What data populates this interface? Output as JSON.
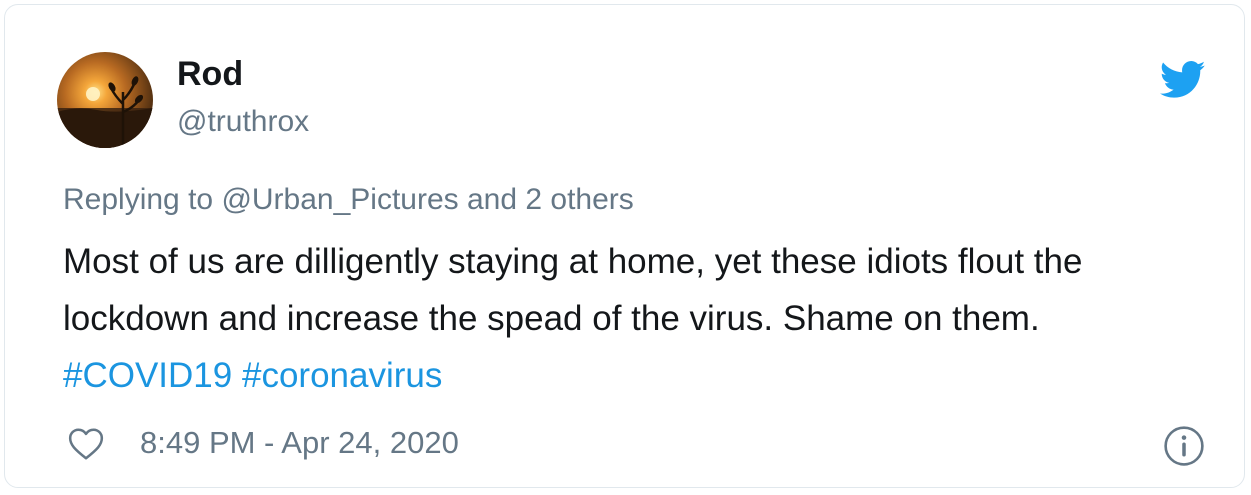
{
  "user": {
    "display_name": "Rod",
    "handle": "@truthrox"
  },
  "tweet": {
    "reply_prefix": "Replying to ",
    "reply_to": "@Urban_Pictures",
    "reply_suffix": " and 2 others",
    "text_main": "Most of us are dilligently staying at home, yet these idiots flout the lockdown and increase the spead of the virus. Shame on them. ",
    "hashtag_1": "#COVID19",
    "hashtag_space": " ",
    "hashtag_2": "#coronavirus",
    "timestamp": "8:49 PM - Apr 24, 2020"
  },
  "icons": {
    "brand": "twitter-bird-icon",
    "like": "heart-icon",
    "info": "info-icon"
  },
  "colors": {
    "brand_blue": "#1da1f2",
    "link_blue": "#1b95e0",
    "text_dark": "#14171a",
    "text_gray": "#657786",
    "border": "#e1e8ed"
  }
}
